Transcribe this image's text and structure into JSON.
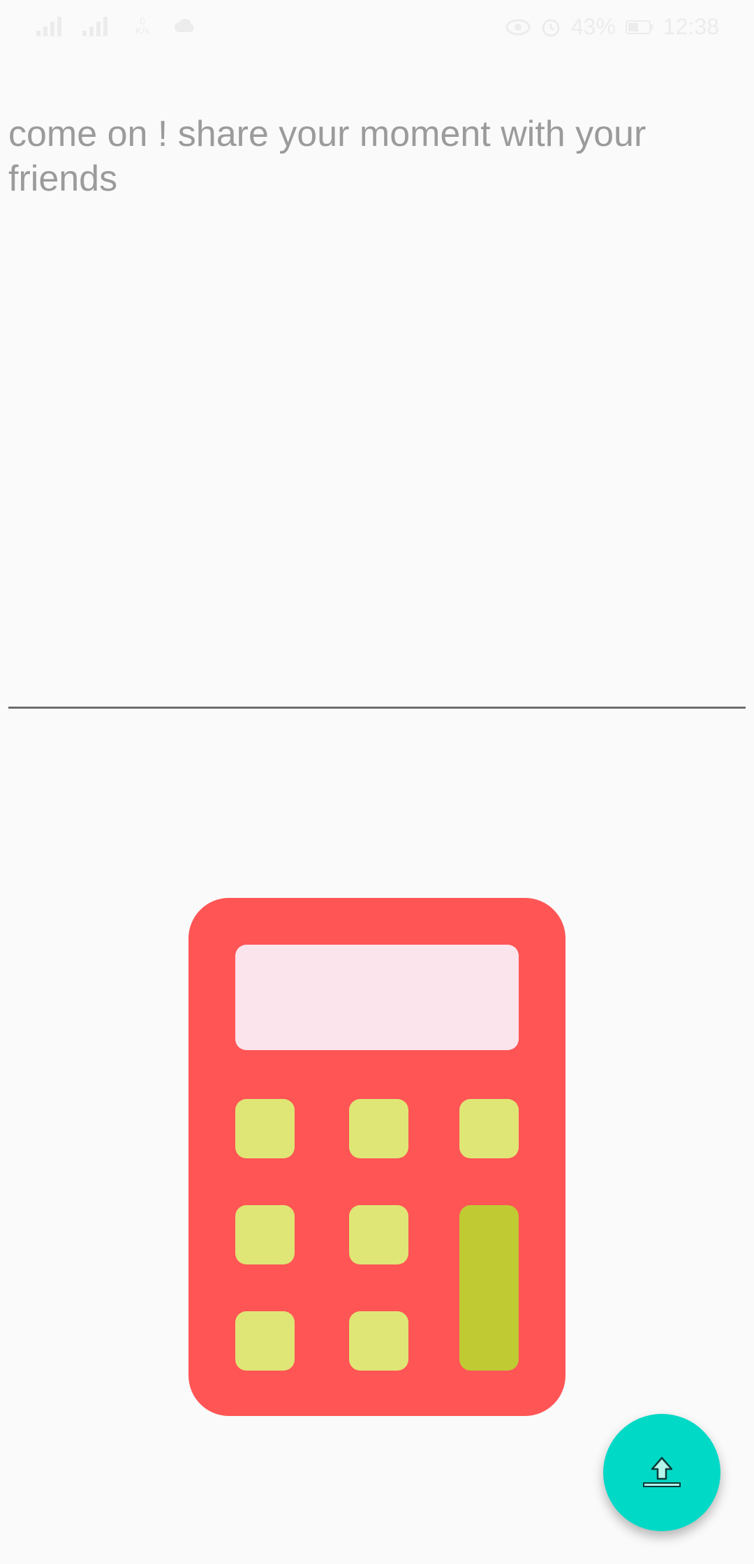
{
  "status_bar": {
    "net_speed_value": "0",
    "net_speed_unit": "K/s",
    "battery_text": "43%",
    "time": "12:38",
    "icons": [
      "signal-icon",
      "signal-icon-2",
      "cloud-icon",
      "eye-icon",
      "alarm-icon",
      "battery-icon"
    ]
  },
  "composer": {
    "caption_text": "come on ! share your moment with your friends"
  },
  "illustration": {
    "name": "calculator-icon",
    "colors": {
      "body": "#ff5555",
      "screen": "#fce4ec",
      "key": "#dfe675",
      "key_accent": "#c0ca33"
    }
  },
  "fab": {
    "icon": "upload-icon",
    "color": "#00d9c6"
  }
}
